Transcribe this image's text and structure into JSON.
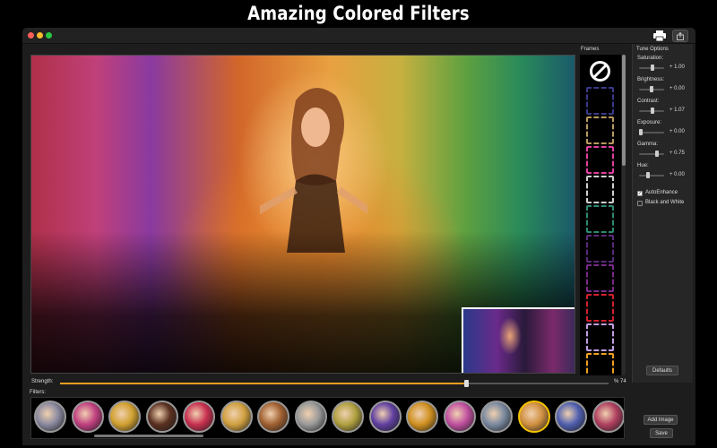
{
  "banner": {
    "title": "Amazing Colored Filters"
  },
  "window": {
    "toolbar": {
      "print_icon": "printer-icon",
      "share_icon": "share-icon"
    }
  },
  "frames": {
    "label": "Frames",
    "items": [
      {
        "name": "none",
        "icon": "no-frame-icon",
        "color": "#ffffff"
      },
      {
        "name": "frame-1",
        "color": "#3a3a8a"
      },
      {
        "name": "frame-2",
        "color": "#b89a60"
      },
      {
        "name": "frame-3",
        "color": "#e040a0"
      },
      {
        "name": "frame-4",
        "color": "#cfcfcf"
      },
      {
        "name": "frame-5",
        "color": "#2a8a70"
      },
      {
        "name": "frame-6",
        "color": "#5a2a7a"
      },
      {
        "name": "frame-7",
        "color": "#7a2a8a"
      },
      {
        "name": "frame-8",
        "color": "#d02030"
      },
      {
        "name": "frame-9",
        "color": "#c0a0e0"
      },
      {
        "name": "frame-10",
        "color": "#f0a020"
      }
    ]
  },
  "tune": {
    "title": "Tune Options",
    "sliders": [
      {
        "label": "Saturation:",
        "value": "+ 1.00",
        "level": 0.55
      },
      {
        "label": "Brightness:",
        "value": "+ 0.00",
        "level": 0.5
      },
      {
        "label": "Contrast:",
        "value": "+ 1.07",
        "level": 0.55
      },
      {
        "label": "Exposure:",
        "value": "+ 0.00",
        "level": 0.0
      },
      {
        "label": "Gamma:",
        "value": "+ 0.75",
        "level": 0.75
      },
      {
        "label": "Hue:",
        "value": "+ 0.00",
        "level": 0.35
      }
    ],
    "checkboxes": [
      {
        "label": "AutoEnhance",
        "checked": true
      },
      {
        "label": "Black and White",
        "checked": false
      }
    ],
    "defaults_label": "Defaults"
  },
  "strength": {
    "label": "Strength:",
    "value": "% 74",
    "level": 0.74
  },
  "filters": {
    "label": "Filters:",
    "selected_index": 13,
    "items": [
      {
        "color": "#8a8aa0"
      },
      {
        "color": "#c04080"
      },
      {
        "color": "#d0a030"
      },
      {
        "color": "#5a3020"
      },
      {
        "color": "#c83050"
      },
      {
        "color": "#d0a040"
      },
      {
        "color": "#a06030"
      },
      {
        "color": "#9a9a9a"
      },
      {
        "color": "#b0a040"
      },
      {
        "color": "#6040a0"
      },
      {
        "color": "#d09020"
      },
      {
        "color": "#c050a0"
      },
      {
        "color": "#7a8aa0"
      },
      {
        "color": "#d09040"
      },
      {
        "color": "#5060b0"
      },
      {
        "color": "#b04060"
      }
    ]
  },
  "actions": {
    "add_image_label": "Add Image",
    "save_label": "Save"
  }
}
